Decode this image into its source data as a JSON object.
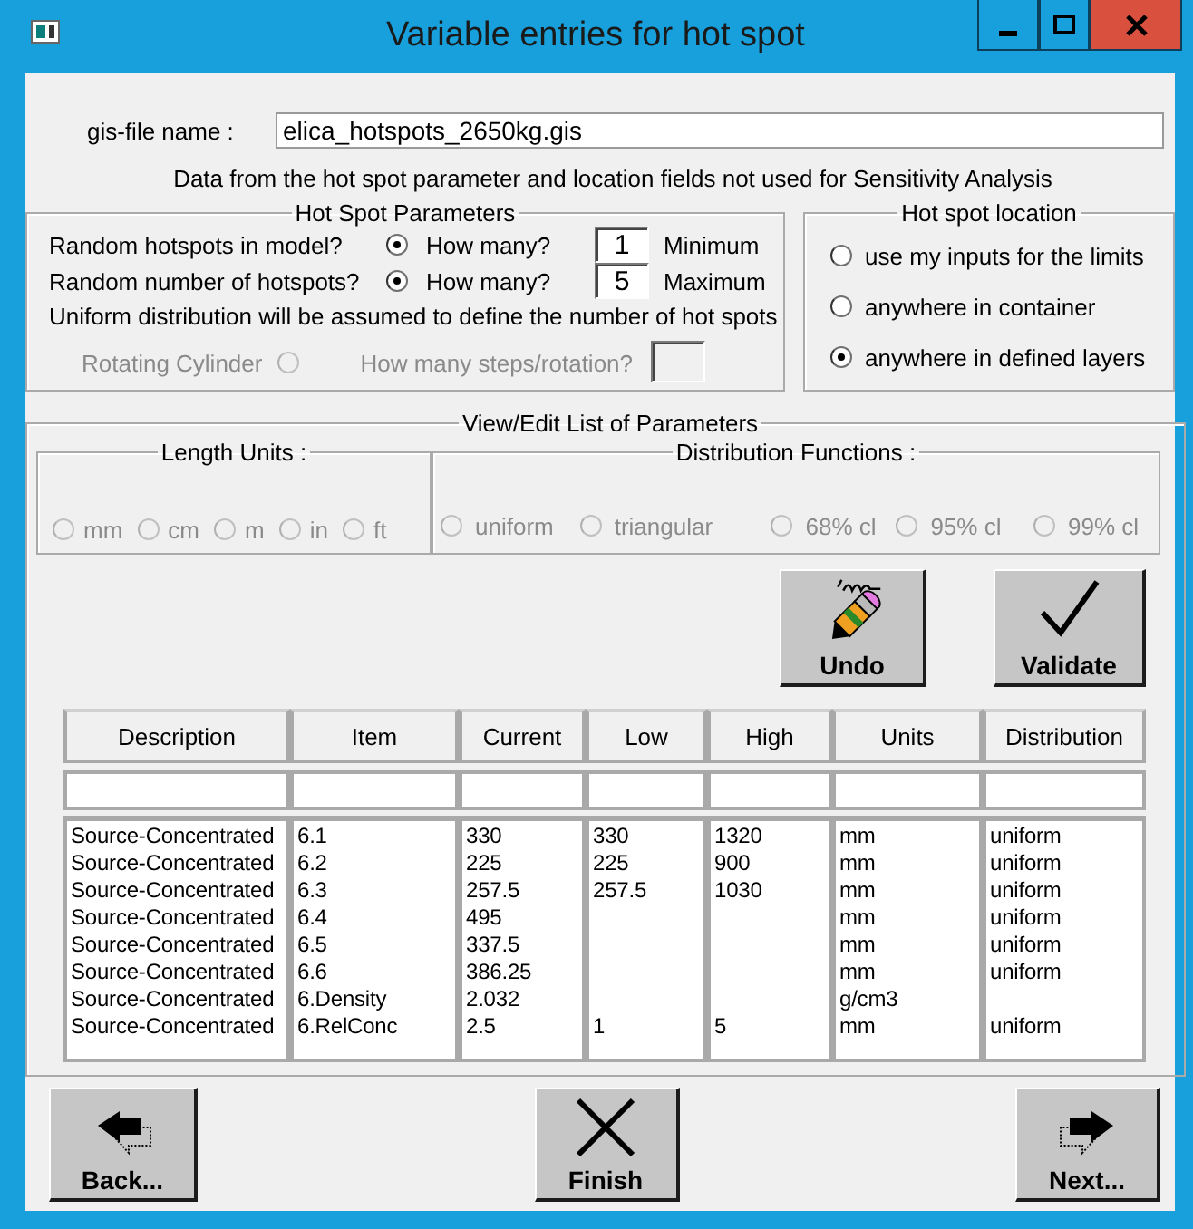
{
  "window": {
    "title": "Variable entries for hot spot"
  },
  "gis_file": {
    "label": "gis-file name :",
    "value": "elica_hotspots_2650kg.gis"
  },
  "note": "Data from the hot spot parameter and location fields not used for Sensitivity Analysis",
  "hot_spot_parameters": {
    "title": "Hot Spot Parameters",
    "rows": [
      {
        "label": "Random hotspots in model?",
        "checked": true,
        "question": "How many?",
        "value": "1",
        "bound": "Minimum"
      },
      {
        "label": "Random number of hotspots?",
        "checked": true,
        "question": "How many?",
        "value": "5",
        "bound": "Maximum"
      }
    ],
    "note": "Uniform distribution will be assumed to define the number of hot spots",
    "rotating_cylinder": {
      "label": "Rotating Cylinder",
      "checked": false,
      "disabled": true,
      "question": "How many steps/rotation?"
    }
  },
  "hot_spot_location": {
    "title": "Hot spot location",
    "options": [
      {
        "label": "use my inputs for the limits",
        "selected": false
      },
      {
        "label": "anywhere in container",
        "selected": false
      },
      {
        "label": "anywhere in defined layers",
        "selected": true
      }
    ]
  },
  "parameters": {
    "title": "View/Edit List of Parameters",
    "length_units": {
      "title": "Length Units :",
      "options": [
        {
          "label": "mm",
          "selected": false,
          "disabled": true
        },
        {
          "label": "cm",
          "selected": false,
          "disabled": true
        },
        {
          "label": "m",
          "selected": false,
          "disabled": true
        },
        {
          "label": "in",
          "selected": false,
          "disabled": true
        },
        {
          "label": "ft",
          "selected": false,
          "disabled": true
        }
      ]
    },
    "distribution_functions": {
      "title": "Distribution Functions :",
      "options": [
        {
          "label": "uniform",
          "selected": false,
          "disabled": true
        },
        {
          "label": "triangular",
          "selected": false,
          "disabled": true
        },
        {
          "label": "68% cl",
          "selected": false,
          "disabled": true
        },
        {
          "label": "95% cl",
          "selected": false,
          "disabled": true
        },
        {
          "label": "99% cl",
          "selected": false,
          "disabled": true
        }
      ]
    },
    "undo_button": "Undo",
    "validate_button": "Validate",
    "table": {
      "columns": [
        "Description",
        "Item",
        "Current",
        "Low",
        "High",
        "Units",
        "Distribution"
      ],
      "rows": [
        {
          "description": "Source-Concentrated",
          "item": "6.1",
          "current": "330",
          "low": "330",
          "high": "1320",
          "units": "mm",
          "distribution": "uniform"
        },
        {
          "description": "Source-Concentrated",
          "item": "6.2",
          "current": "225",
          "low": "225",
          "high": "900",
          "units": "mm",
          "distribution": "uniform"
        },
        {
          "description": "Source-Concentrated",
          "item": "6.3",
          "current": "257.5",
          "low": "257.5",
          "high": "1030",
          "units": "mm",
          "distribution": "uniform"
        },
        {
          "description": "Source-Concentrated",
          "item": "6.4",
          "current": "495",
          "units": "mm",
          "distribution": "uniform"
        },
        {
          "description": "Source-Concentrated",
          "item": "6.5",
          "current": "337.5",
          "units": "mm",
          "distribution": "uniform"
        },
        {
          "description": "Source-Concentrated",
          "item": "6.6",
          "current": "386.25",
          "units": "mm",
          "distribution": "uniform"
        },
        {
          "description": "Source-Concentrated",
          "item": "6.Density",
          "current": "2.032",
          "units": "g/cm3"
        },
        {
          "description": "Source-Concentrated",
          "item": "6.RelConc",
          "current": "2.5",
          "low": "1",
          "high": "5",
          "units": "mm",
          "distribution": "uniform"
        }
      ]
    }
  },
  "footer": {
    "back_button": "Back...",
    "finish_button": "Finish",
    "next_button": "Next..."
  }
}
